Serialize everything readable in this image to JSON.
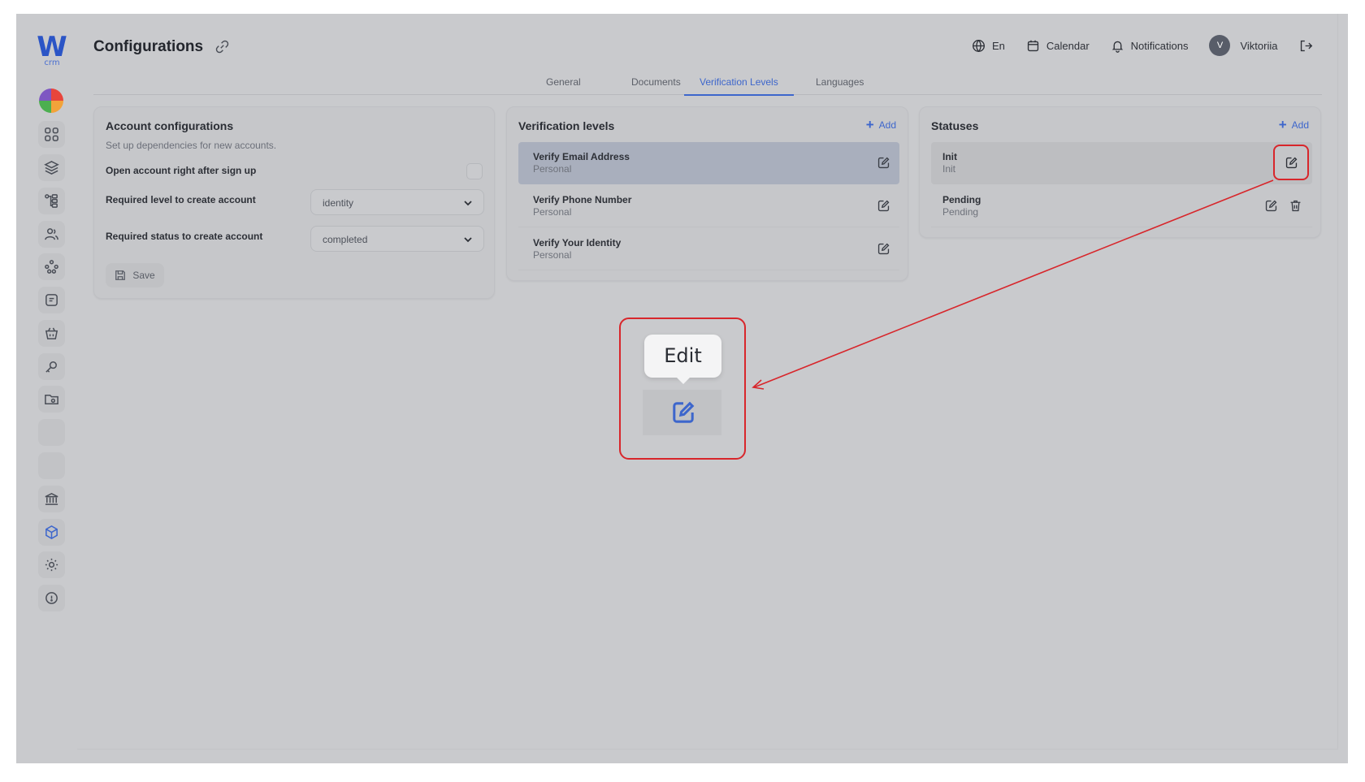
{
  "app": {
    "logo_letter": "W",
    "logo_sub": "crm"
  },
  "header": {
    "title": "Configurations",
    "language": "En",
    "calendar": "Calendar",
    "notifications": "Notifications",
    "user_initial": "V",
    "user_name": "Viktoriia"
  },
  "tabs": [
    {
      "label": "General"
    },
    {
      "label": "Documents"
    },
    {
      "label": "Verification Levels"
    },
    {
      "label": "Languages"
    }
  ],
  "account_config": {
    "title": "Account configurations",
    "subtitle": "Set up dependencies for new accounts.",
    "open_account_label": "Open account right  after sign up",
    "required_level_label": "Required level to create account",
    "required_level_value": "identity",
    "required_status_label": "Required status to create account",
    "required_status_value": "completed",
    "save_label": "Save"
  },
  "verification_levels": {
    "title": "Verification levels",
    "add_label": "Add",
    "items": [
      {
        "name": "Verify Email Address",
        "sub": "Personal"
      },
      {
        "name": "Verify Phone Number",
        "sub": "Personal"
      },
      {
        "name": "Verify Your Identity",
        "sub": "Personal"
      }
    ]
  },
  "statuses": {
    "title": "Statuses",
    "add_label": "Add",
    "items": [
      {
        "name": "Init",
        "sub": "Init"
      },
      {
        "name": "Pending",
        "sub": "Pending"
      }
    ]
  },
  "callout": {
    "tooltip": "Edit"
  },
  "colors": {
    "accent": "#3d66cc",
    "highlight": "#d8262b"
  }
}
